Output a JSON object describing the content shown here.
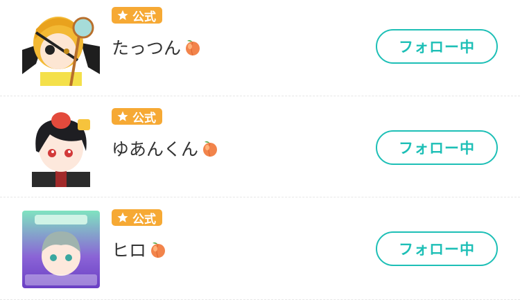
{
  "colors": {
    "badge": "#f6a934",
    "follow_accent": "#1dbfb6",
    "divider": "#e6e6e6"
  },
  "users": [
    {
      "badge_label": "公式",
      "name": "たっつん",
      "name_icon": "peach-emoji",
      "follow_label": "フォロー中"
    },
    {
      "badge_label": "公式",
      "name": "ゆあんくん",
      "name_icon": "peach-emoji",
      "follow_label": "フォロー中"
    },
    {
      "badge_label": "公式",
      "name": "ヒロ",
      "name_icon": "peach-emoji",
      "follow_label": "フォロー中"
    }
  ]
}
